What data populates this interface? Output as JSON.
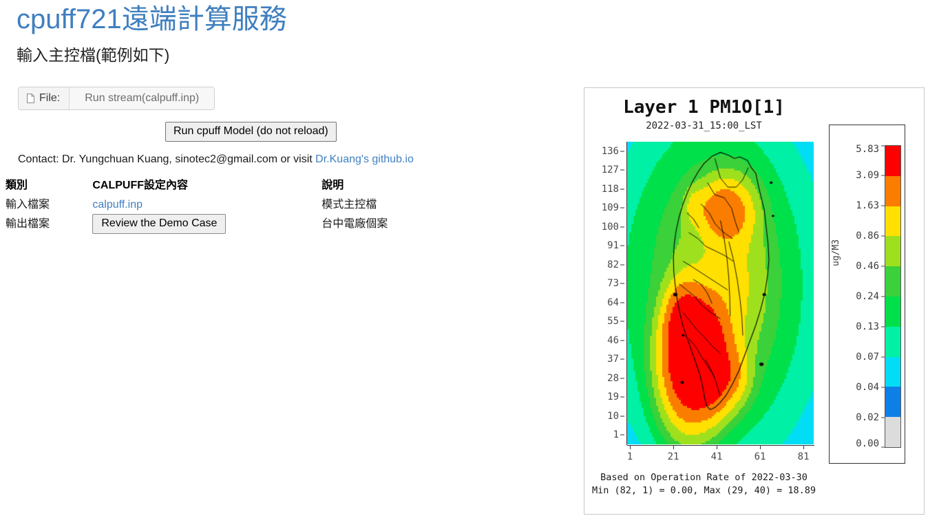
{
  "page": {
    "title": "cpuff721遠端計算服務",
    "subtitle": "輸入主控檔(範例如下)"
  },
  "file_input": {
    "icon": "document-icon",
    "label": "File:",
    "chosen_text": "Run stream(calpuff.inp)"
  },
  "actions": {
    "run_model_label": "Run cpuff Model (do not reload)",
    "review_demo_label": "Review the Demo Case"
  },
  "contact": {
    "prefix": "Contact: Dr. Yungchuan Kuang, sinotec2@gmail.com or visit ",
    "link_text": "Dr.Kuang's github.io"
  },
  "table": {
    "headers": [
      "類別",
      "CALPUFF設定內容",
      "說明"
    ],
    "rows": [
      {
        "category": "輸入檔案",
        "content_link": "calpuff.inp",
        "description": "模式主控檔"
      },
      {
        "category": "輸出檔案",
        "content_button": "Review the Demo Case",
        "description": "台中電廠個案"
      }
    ]
  },
  "chart_data": {
    "type": "heatmap",
    "title": "Layer 1 PM1O[1]",
    "subtitle": "2022-03-31_15:00_LST",
    "xlabel": "",
    "ylabel": "",
    "colorbar_label": "ug/M3",
    "xticks": [
      1,
      21,
      41,
      61,
      81
    ],
    "yticks": [
      136,
      127,
      118,
      109,
      100,
      91,
      82,
      73,
      64,
      55,
      46,
      37,
      28,
      19,
      10,
      1
    ],
    "xlim": [
      1,
      87
    ],
    "ylim": [
      1,
      136
    ],
    "grid": false,
    "colorbar_ticks": [
      "5.83",
      "3.09",
      "1.63",
      "0.86",
      "0.46",
      "0.24",
      "0.13",
      "0.07",
      "0.04",
      "0.02",
      "0.00"
    ],
    "colorbar_values": [
      5.83,
      3.09,
      1.63,
      0.86,
      0.46,
      0.24,
      0.13,
      0.07,
      0.04,
      0.02,
      0.0
    ],
    "colorbar_colors": [
      "#ff0000",
      "#fa7d00",
      "#ffe000",
      "#9fe01e",
      "#3ad13a",
      "#00e04a",
      "#00f0a5",
      "#00ddf5",
      "#0f7fe8",
      "#dcdcdc"
    ],
    "background_color": "#dcdcdc",
    "notes": [
      "Based on Operation Rate of 2022-03-30",
      "Min (82, 1) = 0.00, Max (29, 40) = 18.89"
    ],
    "min": {
      "i": 82,
      "j": 1,
      "value": 0.0
    },
    "max": {
      "i": 29,
      "j": 40,
      "value": 18.89
    },
    "plume": {
      "center_x": 38,
      "center_y": 44,
      "description": "PM10 concentration plume over Taiwan, peak over southwest coast"
    }
  },
  "colors": {
    "link": "#3f7fbf",
    "title": "#3f7fbf",
    "text": "#1a1a1a"
  }
}
